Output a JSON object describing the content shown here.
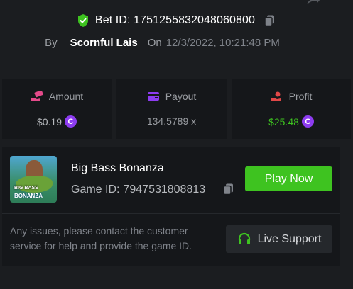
{
  "header": {
    "bet_label": "Bet ID:",
    "bet_id": "1751255832048060800",
    "by_label": "By",
    "author": "Scornful Lais",
    "on_label": "On",
    "date": "12/3/2022, 10:21:48 PM"
  },
  "stats": {
    "amount": {
      "label": "Amount",
      "value": "$0.19",
      "icon": "money-hand-icon",
      "coin": "C"
    },
    "payout": {
      "label": "Payout",
      "value": "134.5789 x",
      "icon": "card-icon"
    },
    "profit": {
      "label": "Profit",
      "value": "$25.48",
      "icon": "hand-coin-icon",
      "coin": "C"
    }
  },
  "game": {
    "name": "Big Bass Bonanza",
    "id_label": "Game ID:",
    "id": "7947531808813",
    "thumb_line1": "BIG BASS",
    "thumb_line2": "BONANZA",
    "play_label": "Play Now"
  },
  "support": {
    "text": "Any issues, please contact the customer service for help and provide the game ID.",
    "button_label": "Live Support"
  },
  "colors": {
    "accent_green": "#3ec320",
    "profit_green": "#3ec320",
    "amount_pink": "#e44a8a",
    "payout_purple": "#8d3cf0",
    "profit_red": "#e14848",
    "background": "#1b1d20",
    "panel": "#15171a"
  }
}
